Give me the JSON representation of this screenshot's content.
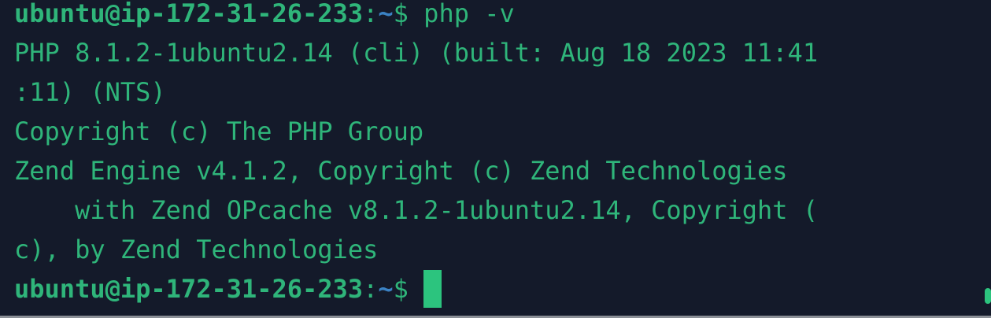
{
  "terminal": {
    "prompt_user_host": "ubuntu@ip-172-31-26-233",
    "prompt_colon": ":",
    "prompt_path": "~",
    "prompt_symbol": "$",
    "command": " php -v",
    "output": [
      "PHP 8.1.2-1ubuntu2.14 (cli) (built: Aug 18 2023 11:41",
      ":11) (NTS)",
      "Copyright (c) The PHP Group",
      "Zend Engine v4.1.2, Copyright (c) Zend Technologies",
      "    with Zend OPcache v8.1.2-1ubuntu2.14, Copyright (",
      "c), by Zend Technologies"
    ]
  },
  "colors": {
    "background": "#141a2a",
    "text": "#2fb57a",
    "path": "#3b82c4",
    "cursor": "#2cc47e"
  }
}
